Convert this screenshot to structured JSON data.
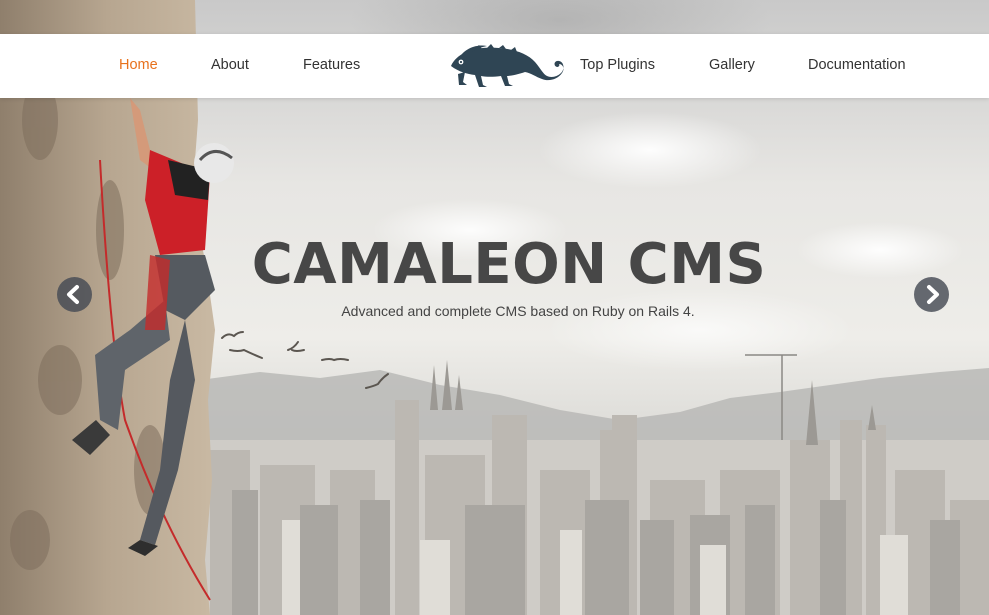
{
  "nav": {
    "left_items": [
      {
        "label": "Home",
        "active": true
      },
      {
        "label": "About",
        "active": false
      },
      {
        "label": "Features",
        "active": false
      }
    ],
    "right_items": [
      {
        "label": "Top Plugins",
        "active": false
      },
      {
        "label": "Gallery",
        "active": false
      },
      {
        "label": "Documentation",
        "active": false
      }
    ],
    "logo_icon": "chameleon-icon"
  },
  "hero": {
    "title": "CAMALEON CMS",
    "subtitle": "Advanced and complete CMS based on Ruby on Rails 4.",
    "prev_icon": "chevron-left-icon",
    "next_icon": "chevron-right-icon"
  },
  "colors": {
    "active_link": "#e8711c",
    "link": "#333333",
    "logo": "#2f4554",
    "title": "#474747",
    "arrow_bg": "#464a54"
  }
}
